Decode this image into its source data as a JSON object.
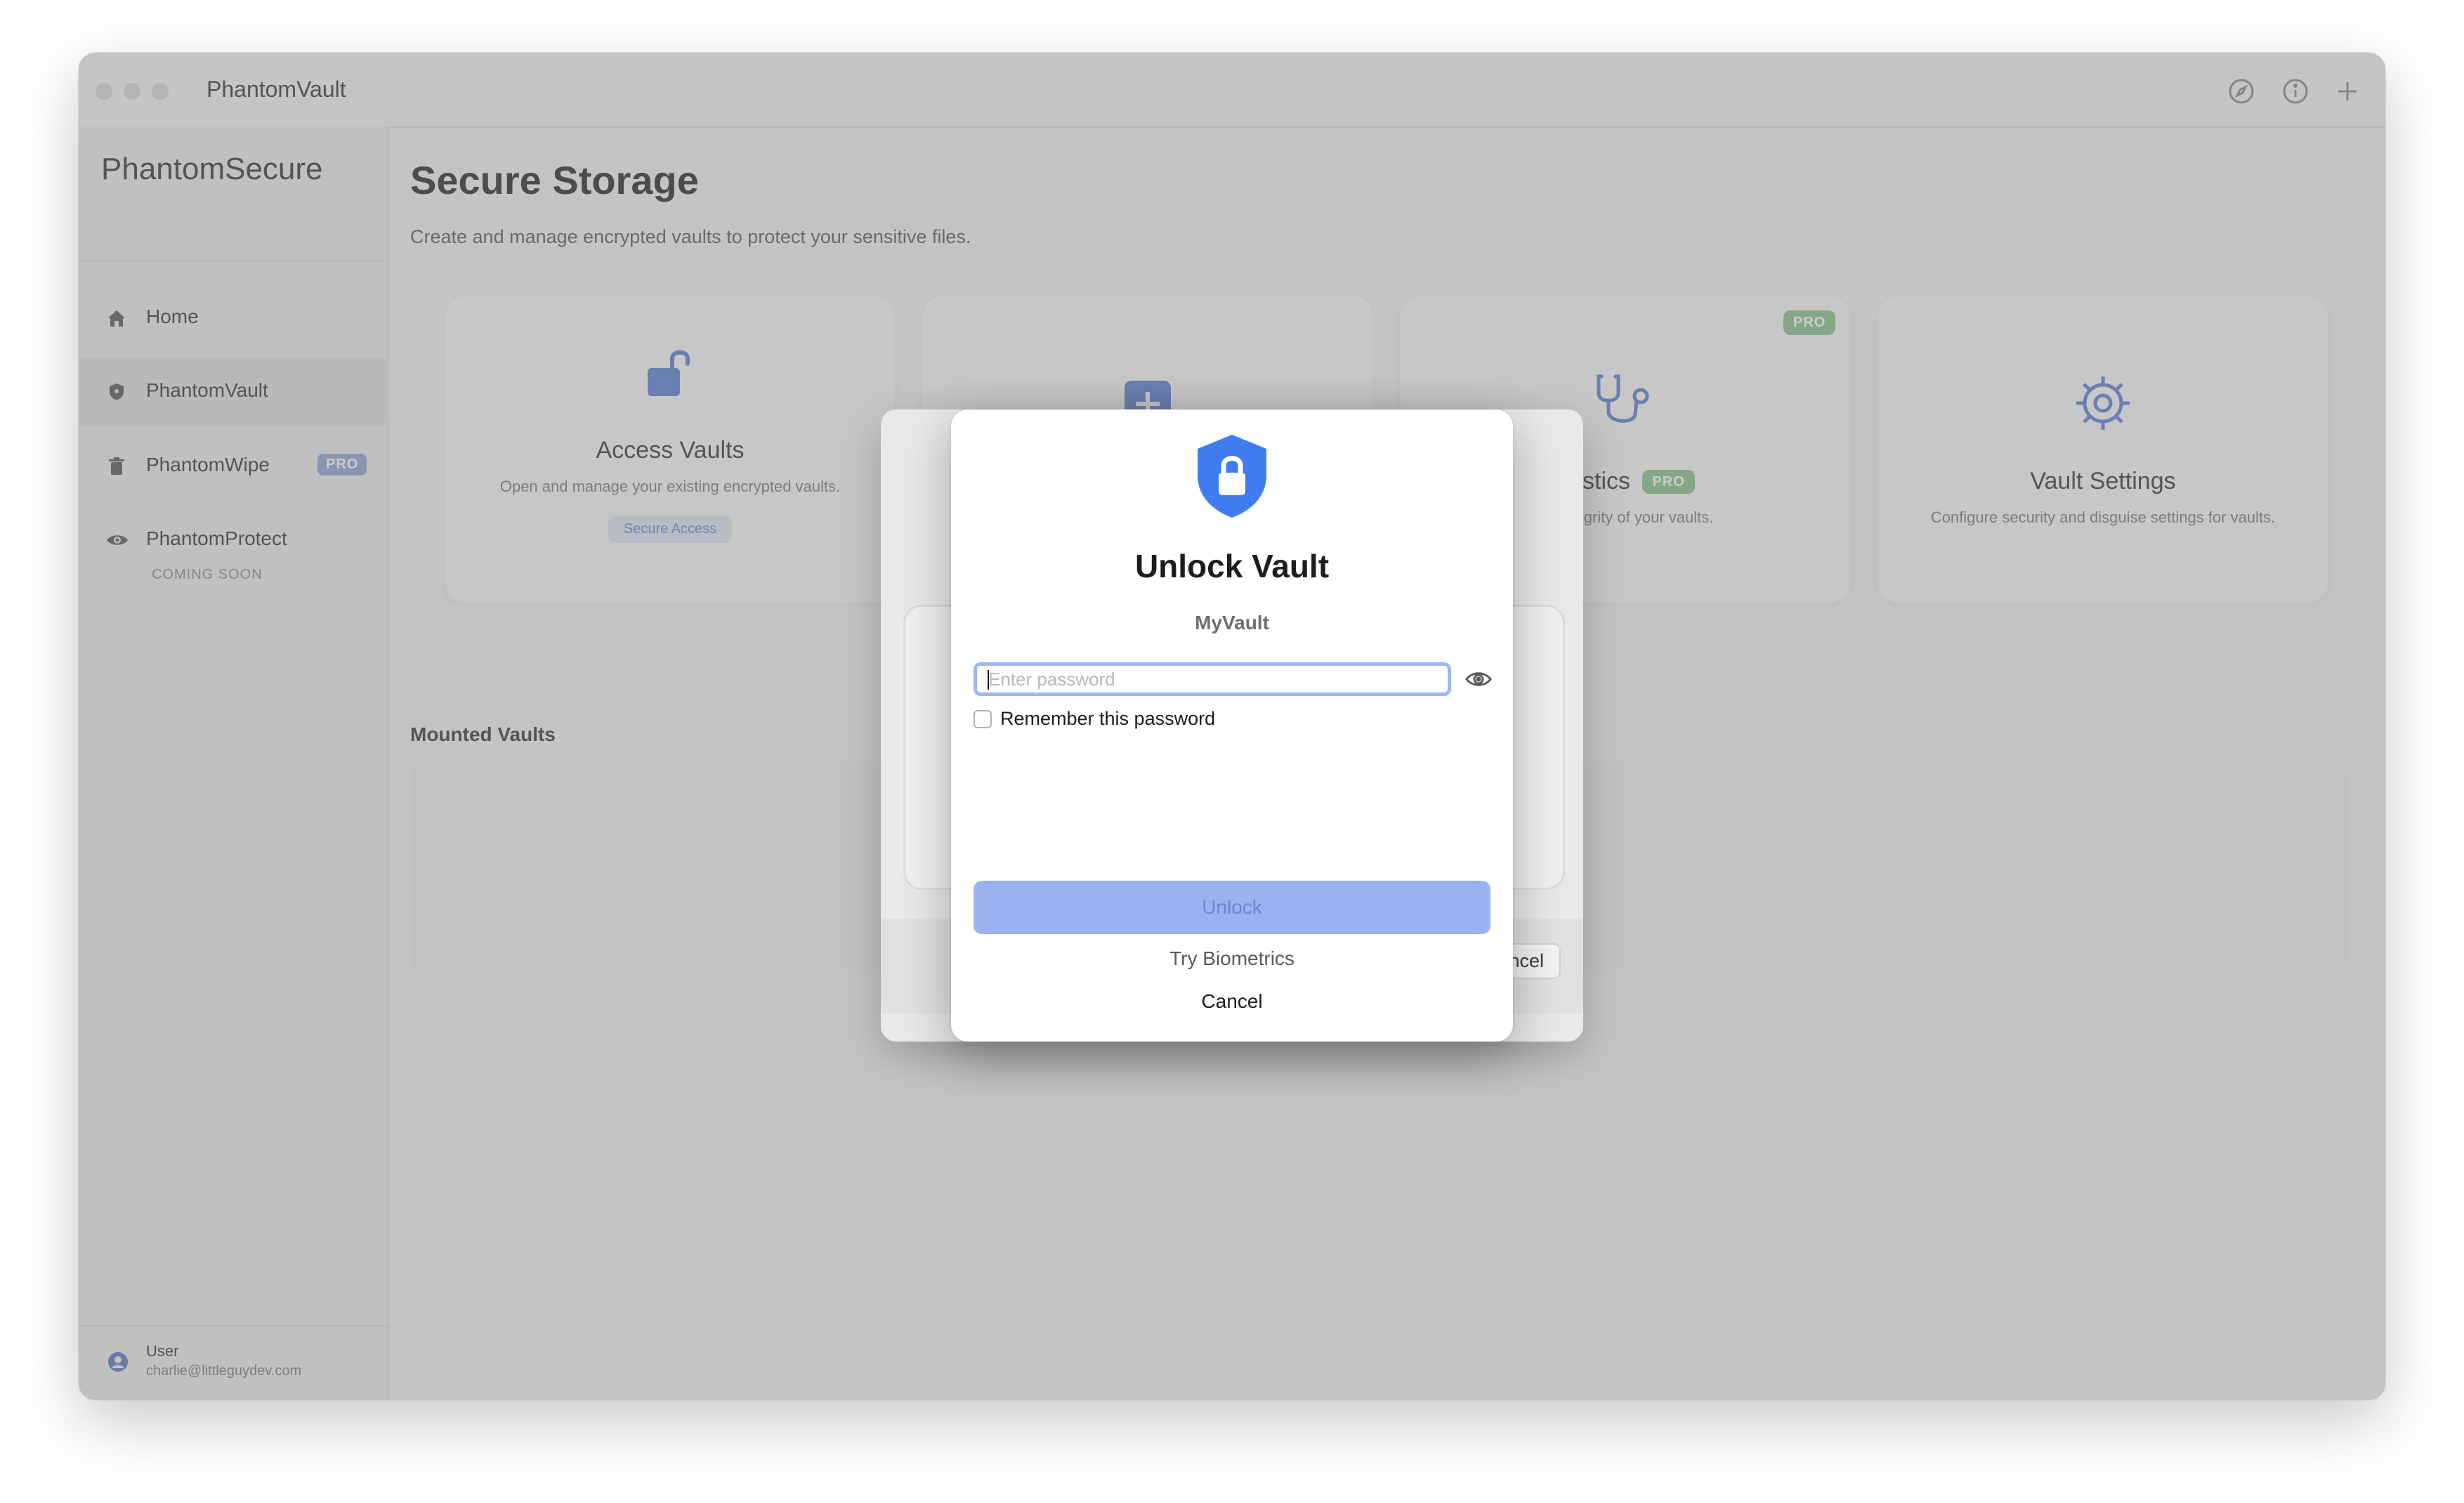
{
  "window": {
    "title": "PhantomVault",
    "toolbar_icons": [
      "compass-icon",
      "info-icon",
      "plus-icon"
    ]
  },
  "sidebar": {
    "brand": "PhantomSecure",
    "items": [
      {
        "label": "Home",
        "icon": "home-icon"
      },
      {
        "label": "PhantomVault",
        "icon": "shield-icon",
        "active": true
      },
      {
        "label": "PhantomWipe",
        "icon": "trash-icon",
        "badge": "PRO"
      },
      {
        "label": "PhantomProtect",
        "icon": "eye-icon",
        "sublabel": "COMING SOON"
      }
    ],
    "user": {
      "name": "User",
      "email": "charlie@littleguydev.com"
    }
  },
  "main": {
    "title": "Secure Storage",
    "subtitle": "Create and manage encrypted vaults to protect your sensitive files.",
    "cards": [
      {
        "title": "Access Vaults",
        "description": "Open and manage your existing encrypted vaults.",
        "tag": "Secure Access",
        "icon": "unlock-icon"
      },
      {
        "title": "",
        "icon": "plus-square-icon"
      },
      {
        "title": "nostics",
        "description": "nd integrity of your vaults.",
        "badge": "PRO",
        "title_badge": "PRO",
        "icon": "stethoscope-icon"
      },
      {
        "title": "Vault Settings",
        "description": "Configure security and disguise settings for vaults.",
        "icon": "gear-icon"
      }
    ],
    "mounted_title": "Mounted Vaults"
  },
  "underlying_sheet": {
    "cancel_label": "ncel"
  },
  "modal": {
    "title": "Unlock Vault",
    "vault_name": "MyVault",
    "password_placeholder": "Enter password",
    "password_value": "",
    "remember_label": "Remember this password",
    "remember_checked": false,
    "unlock_label": "Unlock",
    "biometrics_label": "Try Biometrics",
    "cancel_label": "Cancel"
  },
  "colors": {
    "accent": "#3e7cf0",
    "button_disabled": "#9ab2f2",
    "pro_badge_blue": "#8fa6d8",
    "pro_badge_green": "#8bc48f"
  }
}
